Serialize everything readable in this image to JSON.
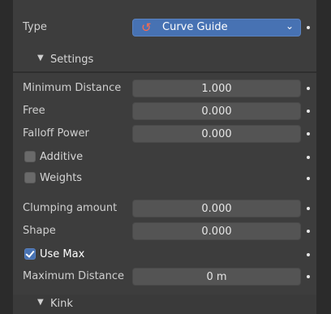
{
  "type_row": {
    "label": "Type",
    "value": "Curve Guide",
    "icon": "curve-guide-icon"
  },
  "settings": {
    "label": "Settings"
  },
  "fields": {
    "minimum_distance": {
      "label": "Minimum Distance",
      "value": "1.000"
    },
    "free": {
      "label": "Free",
      "value": "0.000"
    },
    "falloff_power": {
      "label": "Falloff Power",
      "value": "0.000"
    },
    "clumping_amount": {
      "label": "Clumping amount",
      "value": "0.000"
    },
    "shape": {
      "label": "Shape",
      "value": "0.000"
    },
    "maximum_distance": {
      "label": "Maximum Distance",
      "value": "0 m"
    }
  },
  "checkboxes": {
    "additive": {
      "label": "Additive",
      "checked": false
    },
    "weights": {
      "label": "Weights",
      "checked": false
    },
    "use_max": {
      "label": "Use Max",
      "checked": true
    }
  },
  "kink": {
    "label": "Kink"
  },
  "colors": {
    "accent": "#4772b3",
    "panel": "#3d3d3d",
    "field": "#545454",
    "background": "#2b2b2b"
  }
}
